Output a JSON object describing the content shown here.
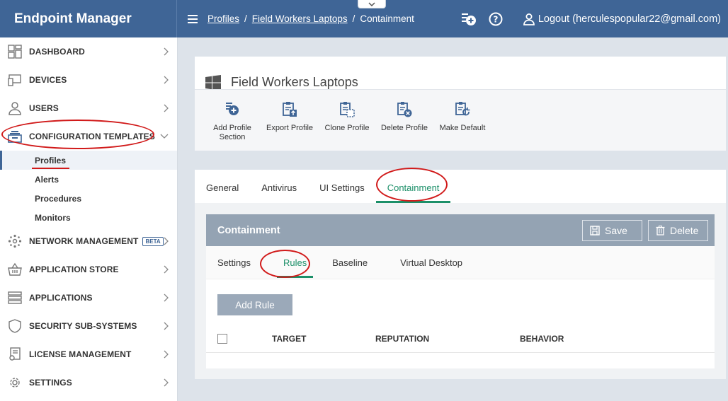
{
  "app": {
    "title": "Endpoint Manager"
  },
  "breadcrumb": {
    "items": [
      "Profiles",
      "Field Workers Laptops"
    ],
    "current": "Containment"
  },
  "header": {
    "logout_label": "Logout (herculespopular22@gmail.com)",
    "icons": [
      "add-circle-icon",
      "help-icon",
      "user-icon"
    ]
  },
  "sidebar": {
    "items": [
      {
        "label": "DASHBOARD",
        "icon": "dashboard-icon"
      },
      {
        "label": "DEVICES",
        "icon": "devices-icon"
      },
      {
        "label": "USERS",
        "icon": "user-icon"
      },
      {
        "label": "CONFIGURATION TEMPLATES",
        "icon": "templates-icon",
        "expanded": true
      },
      {
        "label": "NETWORK MANAGEMENT",
        "icon": "network-icon",
        "badge": "BETA"
      },
      {
        "label": "APPLICATION STORE",
        "icon": "basket-icon"
      },
      {
        "label": "APPLICATIONS",
        "icon": "applications-icon"
      },
      {
        "label": "SECURITY SUB-SYSTEMS",
        "icon": "shield-icon"
      },
      {
        "label": "LICENSE MANAGEMENT",
        "icon": "license-icon"
      },
      {
        "label": "SETTINGS",
        "icon": "gear-icon"
      }
    ],
    "sub_items": [
      "Profiles",
      "Alerts",
      "Procedures",
      "Monitors"
    ],
    "active_sub": "Profiles"
  },
  "profile": {
    "title": "Field Workers Laptops",
    "icon": "windows-icon"
  },
  "toolbar": {
    "add_section_l1": "Add Profile",
    "add_section_l2": "Section",
    "export": "Export Profile",
    "clone": "Clone Profile",
    "delete": "Delete Profile",
    "default": "Make Default"
  },
  "tabs": {
    "items": [
      "General",
      "Antivirus",
      "UI Settings",
      "Containment"
    ],
    "active": "Containment"
  },
  "containment": {
    "title": "Containment",
    "save_label": "Save",
    "delete_label": "Delete",
    "subtabs": [
      "Settings",
      "Rules",
      "Baseline",
      "Virtual Desktop"
    ],
    "active_subtab": "Rules",
    "add_rule_label": "Add Rule",
    "columns": [
      "TARGET",
      "REPUTATION",
      "BEHAVIOR"
    ]
  },
  "colors": {
    "header": "#3f6596",
    "accent_green": "#1b8f68",
    "annotation_red": "#d11a1a"
  }
}
